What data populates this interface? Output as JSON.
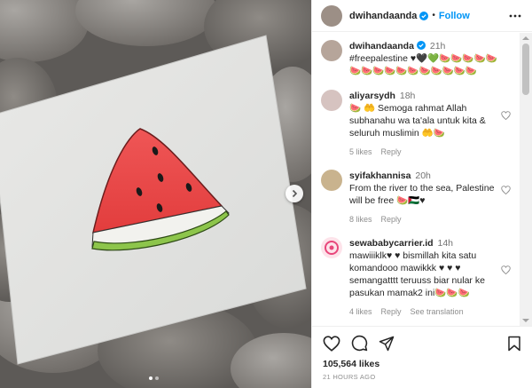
{
  "post": {
    "author": "dwihandaanda",
    "follow_label": "Follow",
    "separator": "•",
    "caption_time": "21h",
    "caption_text": "#freepalestine ♥🖤💚🍉🍉🍉🍉🍉🍉🍉🍉🍉🍉🍉🍉🍉🍉🍉🍉",
    "likes": "105,564 likes",
    "posted": "21 HOURS AGO"
  },
  "comments": [
    {
      "user": "aliyarsydh",
      "time": "18h",
      "text": "🍉 🤲 Semoga rahmat Allah subhanahu wa ta'ala untuk kita & seluruh muslimin 🤲🍉",
      "likes": "5 likes",
      "reply": "Reply"
    },
    {
      "user": "syifakhannisa",
      "time": "20h",
      "text": "From the river to the sea, Palestine will be free 🍉🇵🇸♥",
      "likes": "8 likes",
      "reply": "Reply"
    },
    {
      "user": "sewababycarrier.id",
      "time": "14h",
      "text": "mawiiiklk♥ ♥ bismillah kita satu komandooo mawikkk ♥ ♥ ♥ semangatttt teruuss biar nular ke pasukan mamak2 ini🍉🍉🍉",
      "likes": "4 likes",
      "reply": "Reply",
      "translation": "See translation"
    }
  ],
  "icons": {
    "more": "more-horizontal-icon",
    "like": "heart-outline-icon",
    "comment": "comment-icon",
    "share": "paper-plane-icon",
    "save": "bookmark-icon",
    "next": "chevron-right-icon",
    "verified": "verified-badge-icon"
  },
  "colors": {
    "accent": "#0095f6",
    "text": "#262626",
    "muted": "#8e8e8e",
    "watermelon_red": "#e84a4a",
    "watermelon_rind": "#8bc34a"
  }
}
